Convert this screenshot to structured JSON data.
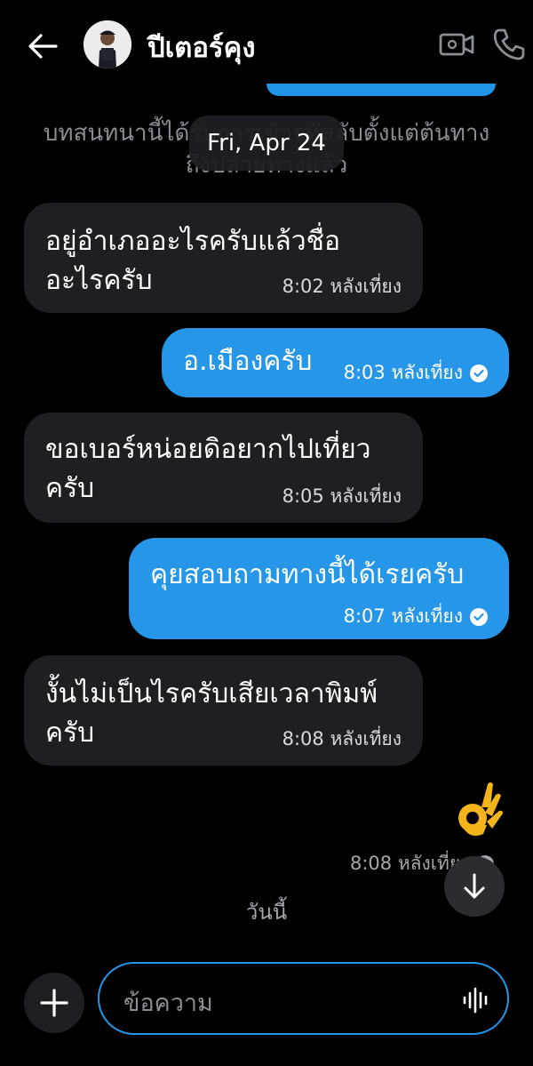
{
  "header": {
    "contact_name": "ปีเตอร์คุง",
    "back_icon": "arrow-left-icon",
    "video_icon": "video-camera-icon",
    "call_icon": "phone-icon"
  },
  "conversation": {
    "system_note_line1": "บทสนทนานี้ได้รับการเข้ารหัสลับตั้งแต่ต้นทาง",
    "system_note_line2": "ถึงปลายทางแล้ว",
    "date_chip": "Fri, Apr 24",
    "messages": [
      {
        "direction": "incoming",
        "lines": [
          "อยู่อำเภออะไรครับแล้วชื่อ",
          "อะไรครับ"
        ],
        "time": "8:02 หลังเที่ยง"
      },
      {
        "direction": "outgoing",
        "lines": [
          "อ.เมืองครับ"
        ],
        "time": "8:03 หลังเที่ยง",
        "status": "read"
      },
      {
        "direction": "incoming",
        "lines": [
          "ขอเบอร์หน่อยดิอยากไปเที่ยว",
          "ครับ"
        ],
        "time": "8:05 หลังเที่ยง"
      },
      {
        "direction": "outgoing",
        "lines": [
          "คุยสอบถามทางนี้ได้เรยครับ"
        ],
        "time": "8:07 หลังเที่ยง",
        "status": "read"
      },
      {
        "direction": "incoming",
        "lines": [
          "งั้นไม่เป็นไรครับเสียเวลาพิมพ์",
          "ครับ"
        ],
        "time": "8:08 หลังเที่ยง"
      },
      {
        "direction": "outgoing",
        "emoji": "👌",
        "time": "8:08 หลังเที่ยง",
        "status": "delivered"
      }
    ],
    "today_label": "วันนี้"
  },
  "composer": {
    "placeholder": "ข้อความ",
    "add_icon": "plus-icon",
    "voice_icon": "voice-waveform-icon",
    "scroll_icon": "arrow-down-icon"
  },
  "colors": {
    "outgoing_bubble": "#2596e8",
    "incoming_bubble": "#1e1f22",
    "background": "#000000",
    "secondary_text": "#8a8d93"
  }
}
